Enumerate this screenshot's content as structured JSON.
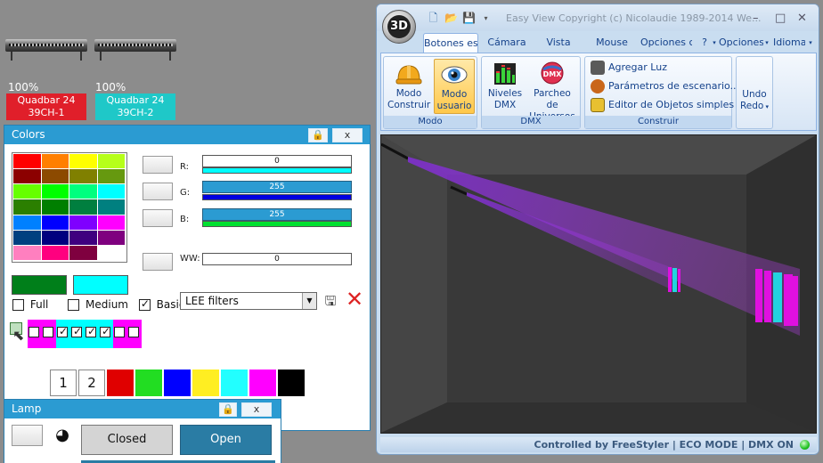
{
  "fixtures": [
    {
      "level": "100%",
      "label": "Quadbar 24\n39CH-1",
      "line1": "Quadbar 24",
      "line2": "39CH-1",
      "color": "#e01f2a"
    },
    {
      "level": "100%",
      "label": "Quadbar 24\n39CH-2",
      "line1": "Quadbar 24",
      "line2": "39CH-2",
      "color": "#1fc8c8"
    }
  ],
  "colors_window": {
    "title": "Colors",
    "lock_icon": "lock-icon",
    "close_label": "x",
    "grid_colors": [
      "#ff0000",
      "#ff7f00",
      "#ffff00",
      "#b6ff1a",
      "#8c0000",
      "#8c4a00",
      "#808000",
      "#66990f",
      "#66ff00",
      "#00ff00",
      "#00ff7f",
      "#00ffff",
      "#2b7f00",
      "#007f00",
      "#007f3f",
      "#008080",
      "#0080ff",
      "#0000ff",
      "#7f00ff",
      "#ff00ff",
      "#004080",
      "#00007f",
      "#3f007f",
      "#7f007f",
      "#ff7fbf",
      "#ff007f",
      "#7f003f",
      "#ffffff"
    ],
    "current_color_a": "#007f1a",
    "current_color_b": "#00ffff",
    "sliders": [
      {
        "label": "R:",
        "value": "0",
        "field_style": "white",
        "bar_color": "#00ffff"
      },
      {
        "label": "G:",
        "value": "255",
        "field_style": "blue",
        "bar_color": "#0000e0"
      },
      {
        "label": "B:",
        "value": "255",
        "field_style": "blue",
        "bar_color": "#00e030"
      },
      {
        "label": "WW:",
        "value": "0",
        "field_style": "white",
        "bar_color": ""
      }
    ],
    "modes": [
      {
        "label": "Full",
        "checked": false
      },
      {
        "label": "Medium",
        "checked": false
      },
      {
        "label": "Basic",
        "checked": true
      }
    ],
    "filter_select": "LEE filters",
    "palette_checkboxes": [
      {
        "color": "#ff00ff",
        "checked": false
      },
      {
        "color": "#ff00ff",
        "checked": false
      },
      {
        "color": "#00ffff",
        "checked": true
      },
      {
        "color": "#00ffff",
        "checked": true
      },
      {
        "color": "#00ffff",
        "checked": true
      },
      {
        "color": "#00ffff",
        "checked": true
      },
      {
        "color": "#ff00ff",
        "checked": false
      },
      {
        "color": "#ff00ff",
        "checked": false
      }
    ],
    "swatch_numbers": [
      "1",
      "2"
    ],
    "swatches": [
      "#e00000",
      "#22dd22",
      "#0000ff",
      "#ffee22",
      "#22ffff",
      "#ff00ff",
      "#000000"
    ]
  },
  "lamp_window": {
    "title": "Lamp",
    "close_label": "x",
    "closed_label": "Closed",
    "open_label": "Open"
  },
  "app": {
    "title": "Easy View   Copyright (c) Nicolaudie 1989-2014   We...",
    "orb_label": "3D",
    "tabs": [
      "Botones es",
      "Cámara",
      "Vista",
      "Mouse",
      "Opciones c",
      "?",
      "Opciones",
      "Idioma"
    ],
    "groups": {
      "modo": {
        "label": "Modo",
        "buttons": [
          {
            "label": "Modo\nConstruir",
            "l1": "Modo",
            "l2": "Construir"
          },
          {
            "label": "Modo\nusuario",
            "l1": "Modo",
            "l2": "usuario"
          }
        ]
      },
      "dmx": {
        "label": "DMX",
        "buttons": [
          {
            "l1": "Niveles",
            "l2": "DMX"
          },
          {
            "l1": "Parcheo de",
            "l2": "Universos"
          }
        ],
        "dmx_badge": "DMX"
      },
      "construir": {
        "label": "Construir",
        "items": [
          "Agregar Luz",
          "Parámetros de escenario...",
          "Editor de Objetos simples"
        ]
      },
      "undo": {
        "l1": "Undo",
        "l2": "Redo"
      }
    },
    "status": "Controlled by FreeStyler  |  ECO MODE  |  DMX ON"
  }
}
